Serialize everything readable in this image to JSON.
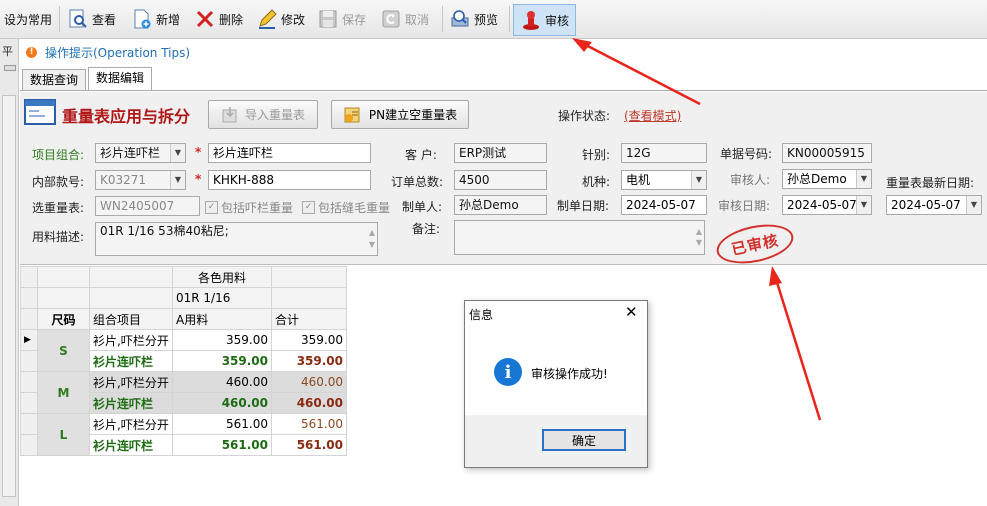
{
  "toolbar": {
    "set_default": "设为常用",
    "view": "查看",
    "add": "新增",
    "delete": "删除",
    "edit": "修改",
    "save": "保存",
    "cancel": "取消",
    "preview": "预览",
    "audit": "审核"
  },
  "left_strip_char": "平",
  "tips": "操作提示(Operation Tips)",
  "tabs": [
    "数据查询",
    "数据编辑"
  ],
  "form": {
    "title": "重量表应用与拆分",
    "import_btn": "导入重量表",
    "pn_btn": "PN建立空重量表",
    "status_label": "操作状态:",
    "status_value": "(查看模式)",
    "labels": {
      "combo": "项目组合:",
      "internal": "内部款号:",
      "weight_sheet": "选重量表:",
      "desc": "用料描述:",
      "customer": "客 户:",
      "order_total": "订单总数:",
      "maker": "制单人:",
      "remark": "备注:",
      "needle": "针别:",
      "machine": "机种:",
      "make_date": "制单日期:",
      "doc_no": "单据号码:",
      "auditor": "审核人:",
      "audit_date": "审核日期:",
      "latest_date": "重量表最新日期:"
    },
    "values": {
      "combo_select": "衫片连吓栏",
      "combo_name": "衫片连吓栏",
      "internal_select": "K03271",
      "internal_name": "KHKH-888",
      "weight_sheet": "WN2405007",
      "chk_rib": "包括吓栏重量",
      "chk_seam": "包括缝毛重量",
      "desc": "01R 1/16 53棉40粘尼;",
      "customer": "ERP测试",
      "order_total": "4500",
      "maker": "孙总Demo",
      "needle": "12G",
      "machine": "电机",
      "make_date": "2024-05-07",
      "doc_no": "KN00005915",
      "auditor": "孙总Demo",
      "audit_date": "2024-05-07",
      "latest_date": "2024-05-07"
    },
    "stamp": "已审核"
  },
  "grid": {
    "group_header": "各色用料",
    "sub_header": "01R 1/16",
    "columns": [
      "尺码",
      "组合项目",
      "A用料",
      "合计"
    ],
    "rows": [
      {
        "size": "S",
        "items": [
          {
            "name": "衫片,吓栏分开",
            "a": "359.00",
            "total": "359.00"
          },
          {
            "name": "衫片连吓栏",
            "a": "359.00",
            "total": "359.00"
          }
        ]
      },
      {
        "size": "M",
        "items": [
          {
            "name": "衫片,吓栏分开",
            "a": "460.00",
            "total": "460.00"
          },
          {
            "name": "衫片连吓栏",
            "a": "460.00",
            "total": "460.00"
          }
        ]
      },
      {
        "size": "L",
        "items": [
          {
            "name": "衫片,吓栏分开",
            "a": "561.00",
            "total": "561.00"
          },
          {
            "name": "衫片连吓栏",
            "a": "561.00",
            "total": "561.00"
          }
        ]
      }
    ]
  },
  "dialog": {
    "title": "信息",
    "message": "审核操作成功!",
    "ok": "确定",
    "close": "✕",
    "icon": "i"
  }
}
